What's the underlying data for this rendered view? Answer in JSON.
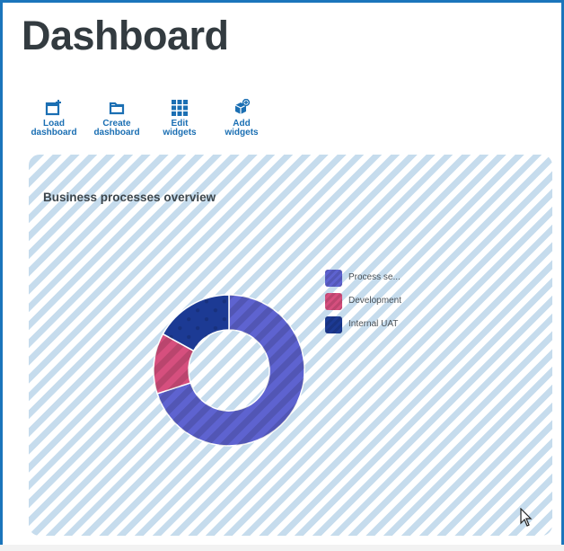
{
  "page": {
    "title": "Dashboard"
  },
  "toolbar": {
    "items": [
      {
        "label": "Load\ndashboard",
        "icon": "load-dashboard-icon"
      },
      {
        "label": "Create\ndashboard",
        "icon": "folder-icon"
      },
      {
        "label": "Edit\nwidgets",
        "icon": "grid-icon"
      },
      {
        "label": "Add\nwidgets",
        "icon": "add-widget-icon"
      }
    ]
  },
  "widget": {
    "title": "Business processes overview",
    "legend": [
      {
        "label": "Process se...",
        "color": "#5e63d0"
      },
      {
        "label": "Development",
        "color": "#d64f7e"
      },
      {
        "label": "Internal UAT",
        "color": "#1c3a94"
      }
    ]
  },
  "chart_data": {
    "type": "pie",
    "title": "Business processes overview",
    "series": [
      {
        "name": "Process se...",
        "value": 0.7
      },
      {
        "name": "Development",
        "value": 0.13
      },
      {
        "name": "Internal UAT",
        "value": 0.17
      }
    ],
    "colors": [
      "#5e63d0",
      "#d64f7e",
      "#1c3a94"
    ],
    "legend": "right",
    "donut": true
  },
  "colors": {
    "accent": "#1b75bb",
    "stripe": "#c6dced"
  }
}
